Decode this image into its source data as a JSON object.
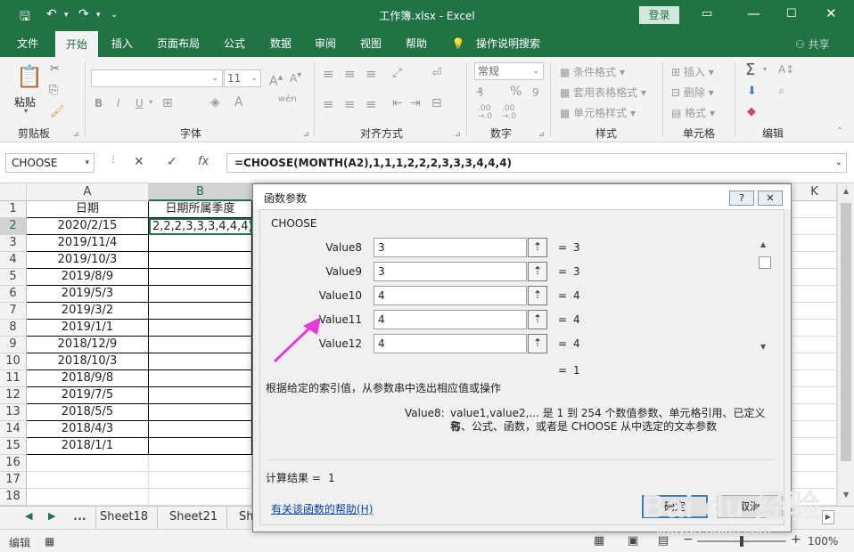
{
  "window": {
    "title": "工作簿.xlsx  -  Excel",
    "login": "登录"
  },
  "tabs": [
    "文件",
    "开始",
    "插入",
    "页面布局",
    "公式",
    "数据",
    "审阅",
    "视图",
    "帮助"
  ],
  "tell_me": "操作说明搜索",
  "share": "共享",
  "ribbon": {
    "paste": "粘贴",
    "groups": [
      "剪贴板",
      "字体",
      "对齐方式",
      "数字",
      "样式",
      "单元格",
      "编辑"
    ],
    "font_size": "11",
    "number_format": "常规",
    "font_tools": [
      "B",
      "I",
      "U"
    ],
    "wen": "wén",
    "styles": [
      "条件格式",
      "套用表格格式",
      "单元格样式"
    ],
    "cells": [
      "插入",
      "删除",
      "格式"
    ],
    "percent": "%",
    "comma": "9",
    "decimals": [
      ".00 →.0",
      ".00 →.0"
    ]
  },
  "formula_bar": {
    "name_box": "CHOOSE",
    "formula": "=CHOOSE(MONTH(A2),1,1,1,2,2,2,3,3,3,4,4,4)",
    "fx": "fx"
  },
  "sheet": {
    "columns": [
      "A",
      "B",
      "K"
    ],
    "rows": [
      "1",
      "2",
      "3",
      "4",
      "5",
      "6",
      "7",
      "8",
      "9",
      "10",
      "11",
      "12",
      "13",
      "14",
      "15",
      "16",
      "17",
      "18"
    ],
    "header_a": "日期",
    "header_b": "日期所属季度",
    "active_cell_text": "2,2,2,3,3,3,4,4,4)",
    "dates": [
      "2020/2/15",
      "2019/11/4",
      "2019/10/3",
      "2019/8/9",
      "2019/5/3",
      "2019/3/2",
      "2019/1/1",
      "2018/12/9",
      "2018/10/3",
      "2018/9/8",
      "2019/7/5",
      "2018/5/5",
      "2018/4/3",
      "2018/1/1"
    ]
  },
  "sheet_tabs": {
    "ellipsis": "...",
    "names": [
      "Sheet18",
      "Sheet21",
      "Sh"
    ]
  },
  "status": {
    "mode": "编辑",
    "zoom": "100%"
  },
  "dialog": {
    "title": "函数参数",
    "help_btn": "?",
    "close_btn": "✕",
    "function_name": "CHOOSE",
    "args": [
      {
        "label": "Value8",
        "input": "3",
        "result": "3"
      },
      {
        "label": "Value9",
        "input": "3",
        "result": "3"
      },
      {
        "label": "Value10",
        "input": "4",
        "result": "4"
      },
      {
        "label": "Value11",
        "input": "4",
        "result": "4"
      },
      {
        "label": "Value12",
        "input": "4",
        "result": "4"
      }
    ],
    "eq": "=",
    "overall_result": "1",
    "description": "根据给定的索引值，从参数串中选出相应值或操作",
    "param_label": "Value8:",
    "param_desc_1": "value1,value2,... 是 1 到 254 个数值参数、单元格引用、已定义名",
    "param_desc_2": "称、公式、函数，或者是 CHOOSE 从中选定的文本参数",
    "calc_result_label": "计算结果 =",
    "calc_result_value": "1",
    "help_link": "有关该函数的帮助(H)",
    "ok": "确定",
    "cancel": "取消"
  },
  "watermark": {
    "line1": "Bai du 经验",
    "line2": "jingyan.baidu.com"
  },
  "colors": {
    "excel_green": "#217346",
    "annotation_arrow": "#e33bd8"
  }
}
